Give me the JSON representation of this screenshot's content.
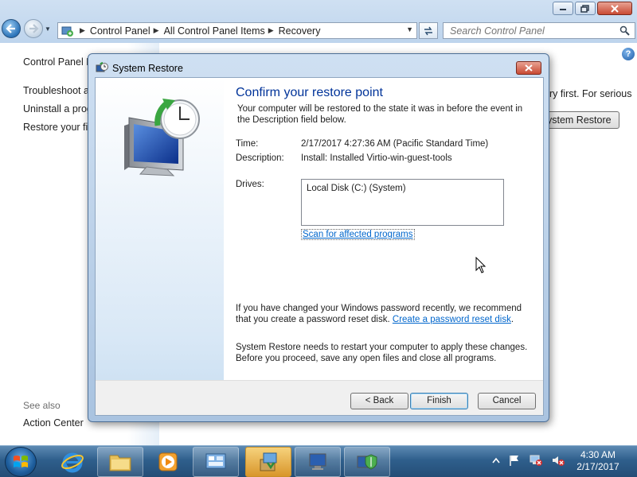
{
  "explorer": {
    "breadcrumb": [
      "Control Panel",
      "All Control Panel Items",
      "Recovery"
    ],
    "search_placeholder": "Search Control Panel",
    "left_links": [
      "Control Panel Home",
      "Troubleshoot a problem",
      "Uninstall a program",
      "Restore your files"
    ],
    "left_links_visible": [
      "Control Panel H",
      "Troubleshoot a",
      "Uninstall a prog",
      "Restore your fil"
    ],
    "see_also_heading": "See also",
    "see_also_links": [
      "Action Center"
    ],
    "bg_text_fragment": "ry first. For serious",
    "bg_button_fragment": "ystem Restore"
  },
  "dialog": {
    "title": "System Restore",
    "heading": "Confirm your restore point",
    "intro": "Your computer will be restored to the state it was in before the event in the Description field below.",
    "time_label": "Time:",
    "time_value": "2/17/2017 4:27:36 AM (Pacific Standard Time)",
    "description_label": "Description:",
    "description_value": "Install: Installed Virtio-win-guest-tools",
    "drives_label": "Drives:",
    "drives": [
      "Local Disk (C:) (System)"
    ],
    "scan_link": "Scan for affected programs",
    "password_note": "If you have changed your Windows password recently, we recommend that you create a password reset disk.",
    "password_note_link": "Create a password reset disk",
    "restart_note": "System Restore needs to restart your computer to apply these changes. Before you proceed, save any open files and close all programs.",
    "buttons": {
      "back": "< Back",
      "finish": "Finish",
      "cancel": "Cancel"
    }
  },
  "taskbar": {
    "pinned": [
      "internet-explorer",
      "windows-explorer",
      "media-player",
      "control-panel",
      "setup-installer",
      "remote-desktop",
      "system-restore"
    ],
    "clock_time": "4:30 AM",
    "clock_date": "2/17/2017"
  },
  "colors": {
    "heading_blue": "#003399",
    "link_blue": "#0066cc",
    "title_glass": "#bcd3ec"
  }
}
